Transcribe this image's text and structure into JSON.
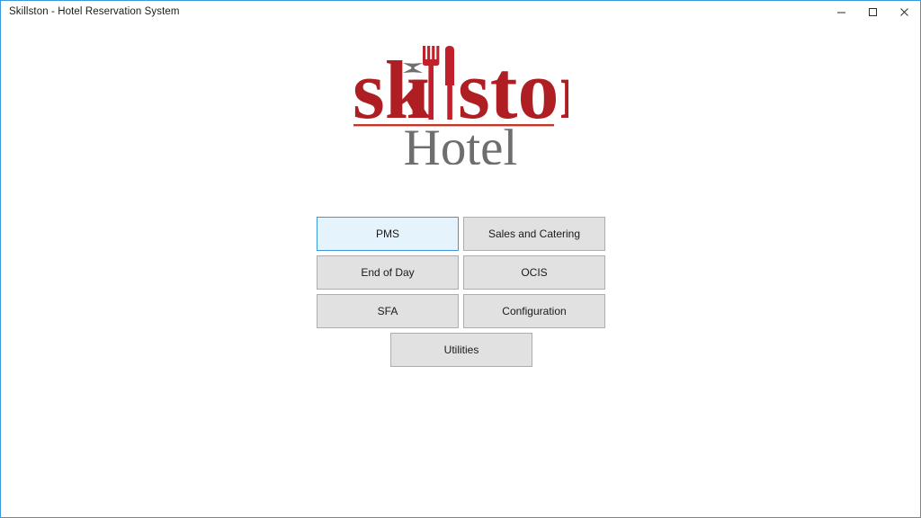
{
  "window": {
    "title": "Skillston - Hotel Reservation System",
    "frame_color": "#3C99DC",
    "controls": [
      {
        "name": "minimize",
        "label": "Minimize"
      },
      {
        "name": "maximize",
        "label": "Maximize"
      },
      {
        "name": "close",
        "label": "Close"
      }
    ]
  },
  "logo": {
    "wordmark": "skillston",
    "subtitle": "Hotel",
    "wordmark_color": "#AF1E23",
    "subtitle_color": "#6E6E6E",
    "rule_color": "#C0392B",
    "icons": [
      "fork-icon",
      "knife-icon",
      "bowtie-icon"
    ]
  },
  "menu": {
    "rows": [
      [
        {
          "label": "PMS",
          "focused": true
        },
        {
          "label": "Sales and Catering",
          "focused": false
        }
      ],
      [
        {
          "label": "End of Day",
          "focused": false
        },
        {
          "label": "OCIS",
          "focused": false
        }
      ],
      [
        {
          "label": "SFA",
          "focused": false
        },
        {
          "label": "Configuration",
          "focused": false
        }
      ],
      [
        {
          "label": "Utilities",
          "focused": false
        }
      ]
    ],
    "button_face": "#E1E1E1",
    "button_border": "#ADADAD",
    "focus_face": "#E5F3FC",
    "focus_border": "#3C99DC"
  }
}
